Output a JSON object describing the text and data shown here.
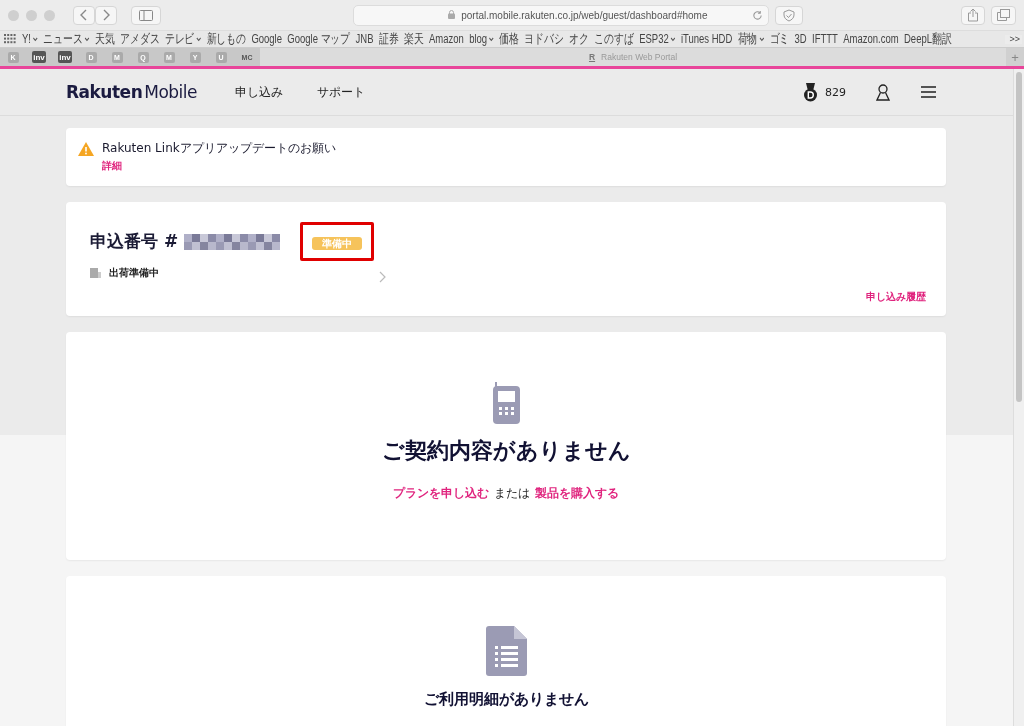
{
  "browser": {
    "url": "portal.mobile.rakuten.co.jp/web/guest/dashboard#home",
    "bookmarks": [
      {
        "label": "Y!",
        "menu": true
      },
      {
        "label": "ニュース",
        "menu": true
      },
      {
        "label": "天気",
        "menu": false
      },
      {
        "label": "アメダス",
        "menu": false
      },
      {
        "label": "テレビ",
        "menu": true
      },
      {
        "label": "新しもの",
        "menu": false
      },
      {
        "label": "Google",
        "menu": false
      },
      {
        "label": "Google マップ",
        "menu": false
      },
      {
        "label": "JNB",
        "menu": false
      },
      {
        "label": "証券",
        "menu": false
      },
      {
        "label": "楽天",
        "menu": false
      },
      {
        "label": "Amazon",
        "menu": false
      },
      {
        "label": "blog",
        "menu": true
      },
      {
        "label": "価格",
        "menu": false
      },
      {
        "label": "ヨドバシ",
        "menu": false
      },
      {
        "label": "オク",
        "menu": false
      },
      {
        "label": "このすば",
        "menu": false
      },
      {
        "label": "ESP32",
        "menu": true
      },
      {
        "label": "iTunes HDD",
        "menu": false
      },
      {
        "label": "荷物",
        "menu": true
      },
      {
        "label": "ゴミ",
        "menu": false
      },
      {
        "label": "3D",
        "menu": false
      },
      {
        "label": "IFTTT",
        "menu": false
      },
      {
        "label": "Amazon.com",
        "menu": false
      },
      {
        "label": "DeepL翻訳",
        "menu": false
      }
    ],
    "more": ">>",
    "pinned_tabs": [
      {
        "label": "K",
        "kind": "letter"
      },
      {
        "label": "inv",
        "kind": "dark"
      },
      {
        "label": "inv",
        "kind": "dark"
      },
      {
        "label": "D",
        "kind": "letter"
      },
      {
        "label": "M",
        "kind": "letter"
      },
      {
        "label": "Q",
        "kind": "letter"
      },
      {
        "label": "M",
        "kind": "letter"
      },
      {
        "label": "Y",
        "kind": "letter"
      },
      {
        "label": "U",
        "kind": "letter"
      },
      {
        "label": "MC",
        "kind": "plain"
      }
    ],
    "tab": {
      "favicon": "R",
      "title": "Rakuten Web Portal"
    },
    "new_tab": "+"
  },
  "header": {
    "logo_bold": "Rakuten",
    "logo_light": "Mobile",
    "nav": [
      "申し込み",
      "サポート"
    ],
    "points": "829"
  },
  "notice": {
    "title": "Rakuten Linkアプリアップデートのお願い",
    "link": "詳細"
  },
  "order": {
    "label": "申込番号 #",
    "status_badge": "準備中",
    "highlighted": true,
    "shipping": "出荷準備中",
    "history_link": "申し込み履歴"
  },
  "contract": {
    "title": "ご契約内容がありません",
    "link1": "プランを申し込む",
    "middle": "または",
    "link2": "製品を購入する"
  },
  "billing": {
    "title": "ご利用明細がありません"
  }
}
